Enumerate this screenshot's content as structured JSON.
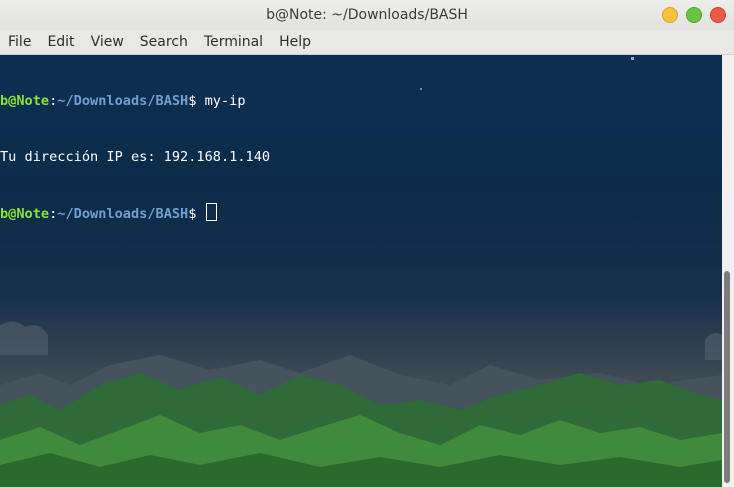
{
  "window": {
    "title": "b@Note: ~/Downloads/BASH"
  },
  "menu": {
    "items": [
      "File",
      "Edit",
      "View",
      "Search",
      "Terminal",
      "Help"
    ]
  },
  "terminal": {
    "lines": [
      {
        "user": "b@Note",
        "sep": ":",
        "path": "~/Downloads/BASH",
        "prompt": "$",
        "command": " my-ip"
      },
      {
        "output": "Tu dirección IP es: 192.168.1.140"
      },
      {
        "user": "b@Note",
        "sep": ":",
        "path": "~/Downloads/BASH",
        "prompt": "$",
        "command": " "
      }
    ]
  },
  "colors": {
    "user": "#8ae234",
    "path": "#729fcf",
    "text": "#ffffff"
  }
}
